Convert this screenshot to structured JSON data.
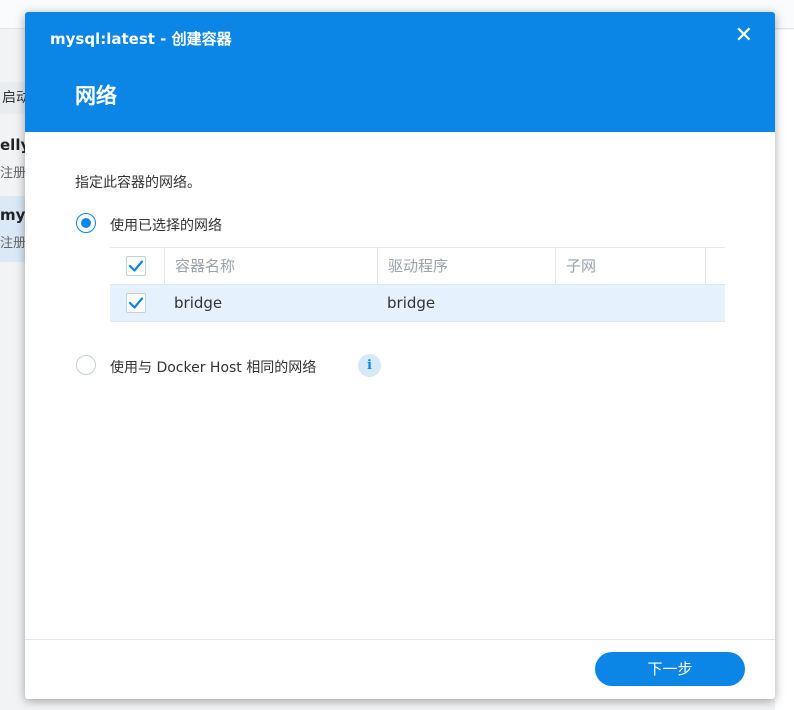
{
  "background": {
    "toolbar_button_label": "启动",
    "rows": [
      {
        "title": "elly",
        "subtitle": "注册"
      },
      {
        "title": "mys",
        "subtitle": "注册"
      }
    ]
  },
  "dialog": {
    "window_title": "mysql:latest - 创建容器",
    "step_title": "网络",
    "description": "指定此容器的网络。",
    "options": {
      "selected_network": {
        "label": "使用已选择的网络",
        "checked": true
      },
      "host_network": {
        "label": "使用与 Docker Host 相同的网络",
        "checked": false
      }
    },
    "table": {
      "columns": [
        "容器名称",
        "驱动程序",
        "子网"
      ],
      "rows": [
        {
          "name": "bridge",
          "driver": "bridge",
          "subnet": "",
          "checked": true
        }
      ]
    },
    "next_button_label": "下一步"
  },
  "colors": {
    "accent": "#0b86e6",
    "selected_row": "#e5f1fc"
  },
  "icons": {
    "close": "close-icon",
    "info": "info-icon",
    "check": "check-icon"
  }
}
